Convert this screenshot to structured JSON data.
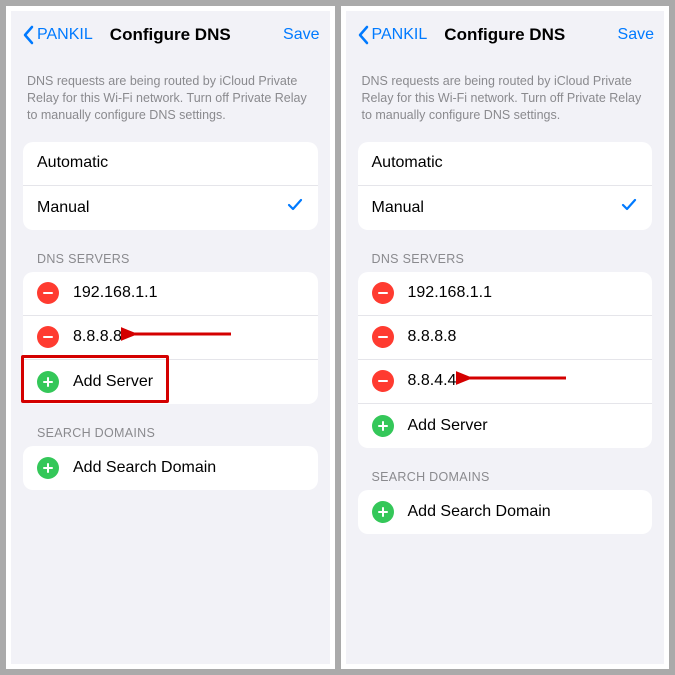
{
  "left": {
    "nav": {
      "back": "PANKIL",
      "title": "Configure DNS",
      "save": "Save"
    },
    "info": "DNS requests are being routed by iCloud Private Relay for this Wi-Fi network. Turn off Private Relay to manually configure DNS settings.",
    "modes": [
      {
        "label": "Automatic",
        "checked": false
      },
      {
        "label": "Manual",
        "checked": true
      }
    ],
    "dns_header": "DNS SERVERS",
    "dns_servers": [
      "192.168.1.1",
      "8.8.8.8"
    ],
    "add_server": "Add Server",
    "search_header": "SEARCH DOMAINS",
    "add_search": "Add Search Domain"
  },
  "right": {
    "nav": {
      "back": "PANKIL",
      "title": "Configure DNS",
      "save": "Save"
    },
    "info": "DNS requests are being routed by iCloud Private Relay for this Wi-Fi network. Turn off Private Relay to manually configure DNS settings.",
    "modes": [
      {
        "label": "Automatic",
        "checked": false
      },
      {
        "label": "Manual",
        "checked": true
      }
    ],
    "dns_header": "DNS SERVERS",
    "dns_servers": [
      "192.168.1.1",
      "8.8.8.8",
      "8.8.4.4"
    ],
    "add_server": "Add Server",
    "search_header": "SEARCH DOMAINS",
    "add_search": "Add Search Domain"
  }
}
